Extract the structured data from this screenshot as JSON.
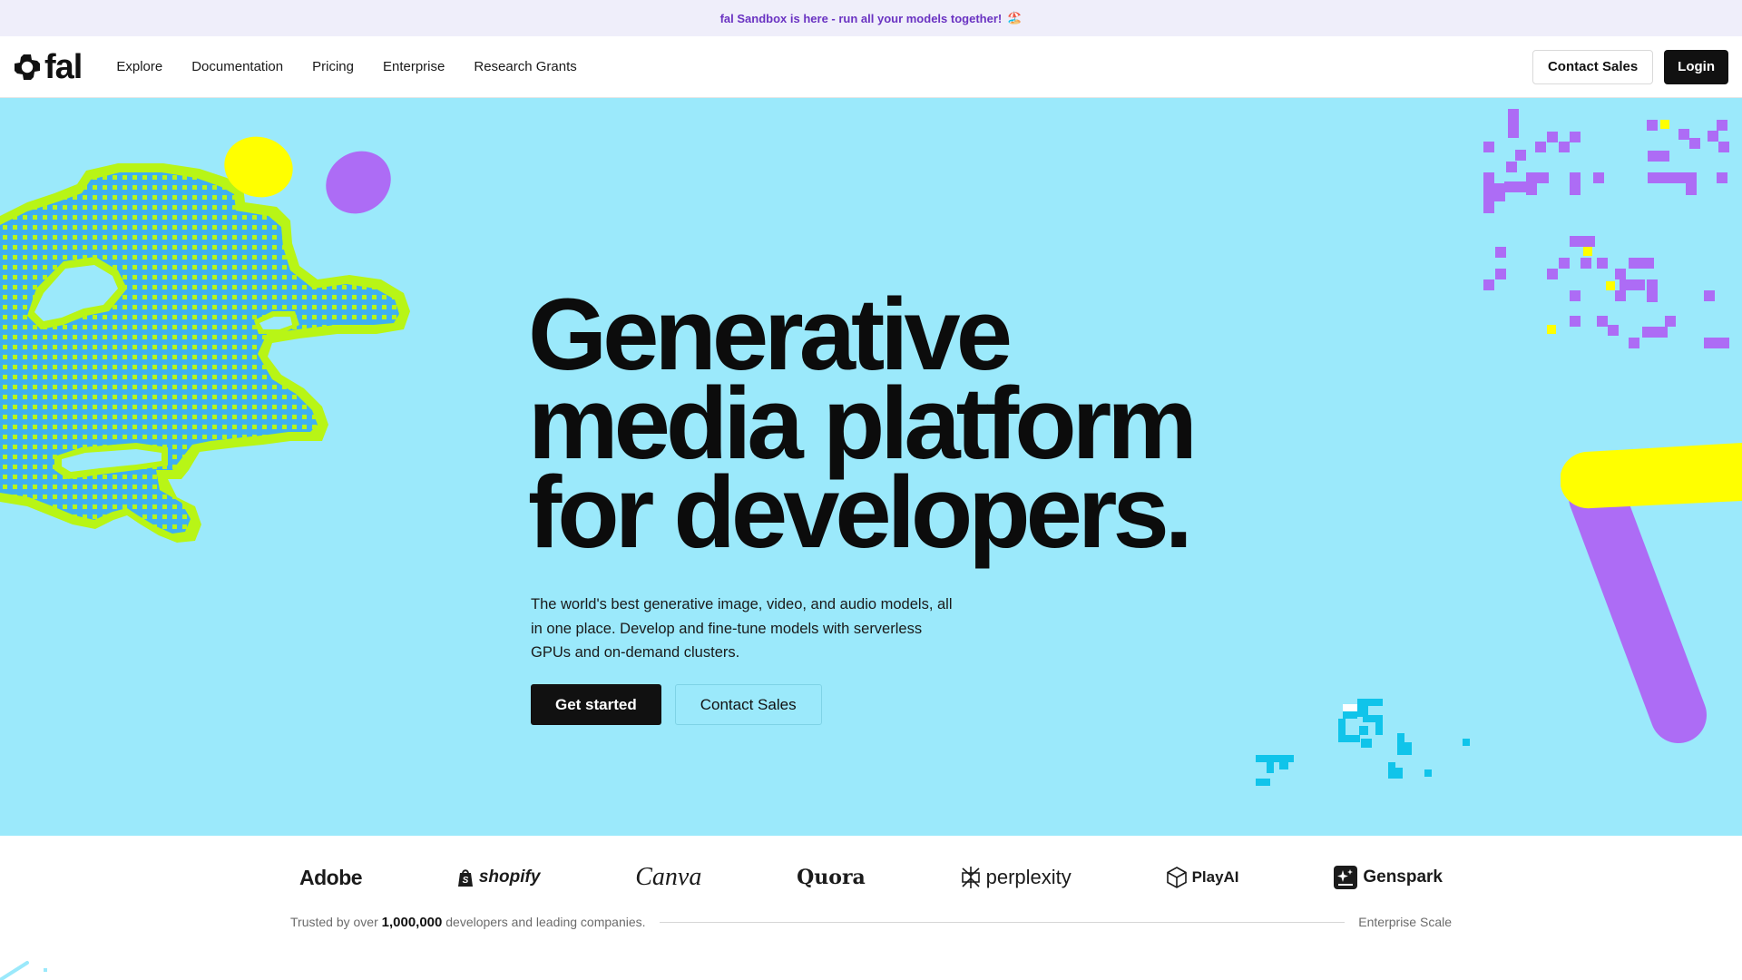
{
  "announcement": {
    "text": "fal Sandbox is here - run all your models together!",
    "emoji": "🏖️"
  },
  "nav": {
    "logo_text": "fal",
    "links": [
      "Explore",
      "Documentation",
      "Pricing",
      "Enterprise",
      "Research Grants"
    ],
    "contact_sales": "Contact Sales",
    "login": "Login"
  },
  "hero": {
    "title_lines": [
      "Generative",
      "media platform",
      "for developers."
    ],
    "subtitle": "The world's best generative image, video, and audio models, all in one place. Develop and fine-tune models with serverless GPUs and on-demand clusters.",
    "cta_primary": "Get started",
    "cta_secondary": "Contact Sales",
    "colors": {
      "background": "#9be9fb",
      "yellow": "#ffff00",
      "purple": "#ad6cf5",
      "lime": "#b8f516",
      "blue": "#3fb0f0",
      "cyan": "#10c4ea"
    }
  },
  "logos": {
    "brands": [
      "Adobe",
      "shopify",
      "Canva",
      "Quora",
      "perplexity",
      "PlayAI",
      "Genspark"
    ],
    "trust_prefix": "Trusted by over",
    "trust_count": "1,000,000",
    "trust_suffix": "developers and leading companies.",
    "enterprise_label": "Enterprise Scale"
  }
}
